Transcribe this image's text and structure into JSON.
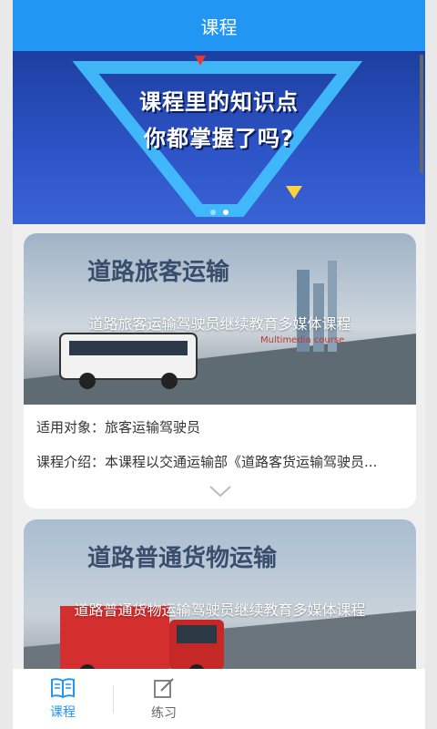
{
  "header": {
    "title": "课程"
  },
  "banner": {
    "line1": "课程里的知识点",
    "line2": "你都掌握了吗?",
    "active_dot": 1
  },
  "courses": [
    {
      "title": "道路旅客运输驾驶员继续教育多媒体课程",
      "cover_heading": "道路旅客运输",
      "cover_sub": "Multimedia course",
      "target": "适用对象：旅客运输驾驶员",
      "intro": "课程介绍：本课程以交通运输部《道路客货运输驾驶员..."
    },
    {
      "title": "道路普通货物运输驾驶员继续教育多媒体课程",
      "cover_heading": "道路普通货物运输"
    }
  ],
  "tabbar": {
    "courses": "课程",
    "practice": "练习"
  },
  "colors": {
    "accent": "#2196f3"
  }
}
